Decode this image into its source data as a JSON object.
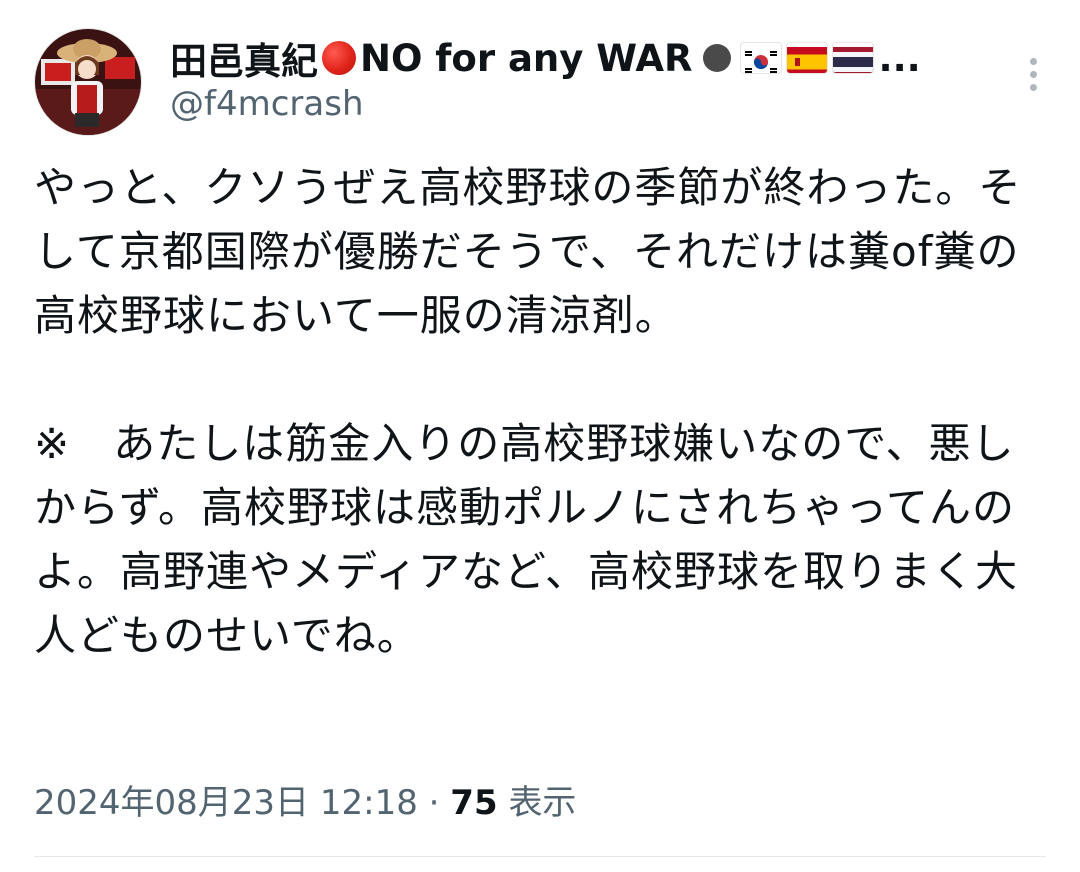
{
  "tweet": {
    "display_name": "田邑真紀",
    "name_suffix": "NO for any WAR",
    "ellipsis": "...",
    "handle": "@f4mcrash",
    "body": "やっと、クソうぜえ高校野球の季節が終わった。そして京都国際が優勝だそうで、それだけは糞of糞の高校野球において一服の清涼剤。\n\n※　あたしは筋金入りの高校野球嫌いなので、悪しからず。高校野球は感動ポルノにされちゃってんのよ。高野連やメディアなど、高校野球を取りまく大人どものせいでね。",
    "timestamp": "2024年08月23日 12:18",
    "separator": "·",
    "view_count": "75",
    "view_label": "表示"
  },
  "colors": {
    "text": "#0f1419",
    "secondary": "#536471",
    "red_dot": "#e0241b"
  },
  "icons": [
    "red-circle-icon",
    "black-circle-icon",
    "korea-flag-icon",
    "spain-flag-icon",
    "thailand-flag-icon",
    "more-options-icon"
  ]
}
